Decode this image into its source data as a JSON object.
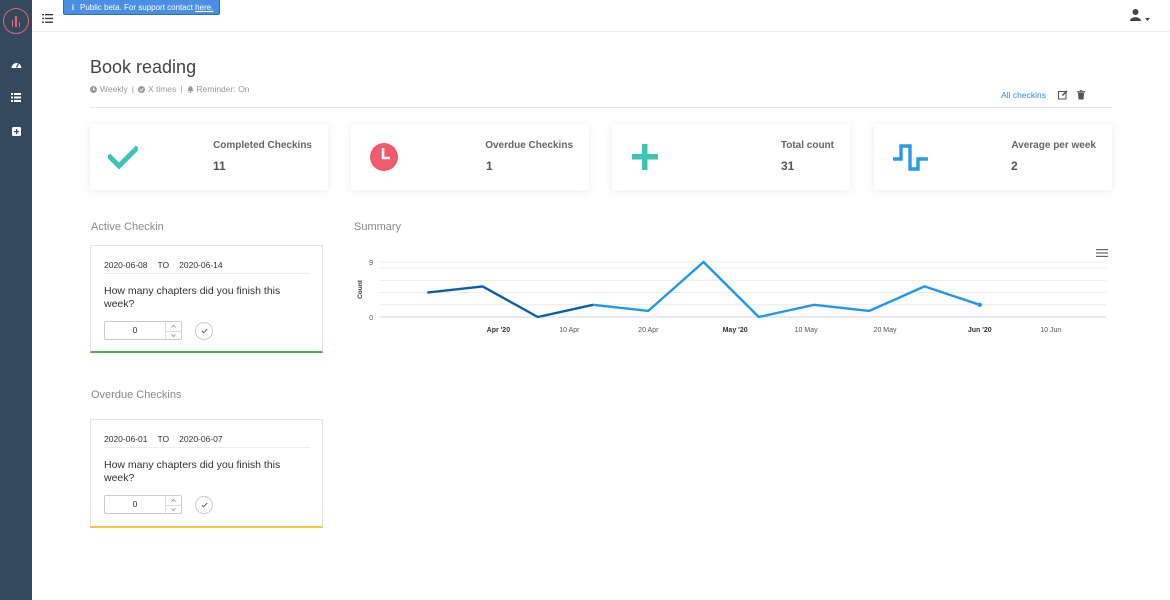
{
  "banner": {
    "info_glyph": "i",
    "text": "Public beta. For support contact ",
    "link": "here.",
    "color": "#4a90e2"
  },
  "sidebar": {
    "items": [
      {
        "icon": "dashboard-icon"
      },
      {
        "icon": "list-icon"
      },
      {
        "icon": "add-icon"
      }
    ],
    "background": "#34495e"
  },
  "header": {
    "title": "Book reading",
    "meta": {
      "frequency": "Weekly",
      "times": "X times",
      "reminder": "Reminder: On",
      "separator": "|"
    },
    "actions": {
      "all_checkins": "All checkins"
    }
  },
  "stats": [
    {
      "label": "Completed Checkins",
      "value": "11",
      "icon": "checkmark-icon",
      "color": "#3cc4b4"
    },
    {
      "label": "Overdue Checkins",
      "value": "1",
      "icon": "clock-icon",
      "color": "#ef5a6f"
    },
    {
      "label": "Total count",
      "value": "31",
      "icon": "plus-icon",
      "color": "#3cc4b4"
    },
    {
      "label": "Average per week",
      "value": "2",
      "icon": "pulse-wave-icon",
      "color": "#2b9ae8"
    }
  ],
  "active": {
    "heading": "Active Checkin",
    "from": "2020-06-08",
    "to_label": "TO",
    "to": "2020-06-14",
    "question": "How many chapters did you finish this week?",
    "value": "0"
  },
  "overdue": {
    "heading": "Overdue Checkins",
    "from": "2020-06-01",
    "to_label": "TO",
    "to": "2020-06-07",
    "question": "How many chapters did you finish this week?",
    "value": "0"
  },
  "summary": {
    "heading": "Summary"
  },
  "chart_data": {
    "type": "line",
    "title": "",
    "ylabel": "Count",
    "ylim": [
      0,
      9
    ],
    "yticks": [
      "0",
      "9"
    ],
    "xticks": [
      {
        "label": "Apr '20",
        "bold": true,
        "date": "2020-04-01"
      },
      {
        "label": "10 Apr",
        "bold": false,
        "date": "2020-04-10"
      },
      {
        "label": "20 Apr",
        "bold": false,
        "date": "2020-04-20"
      },
      {
        "label": "May '20",
        "bold": true,
        "date": "2020-05-01"
      },
      {
        "label": "10 May",
        "bold": false,
        "date": "2020-05-10"
      },
      {
        "label": "20 May",
        "bold": false,
        "date": "2020-05-20"
      },
      {
        "label": "Jun '20",
        "bold": true,
        "date": "2020-06-01"
      },
      {
        "label": "10 Jun",
        "bold": false,
        "date": "2020-06-10"
      }
    ],
    "x": [
      "2020-03-23",
      "2020-03-30",
      "2020-04-06",
      "2020-04-13",
      "2020-04-20",
      "2020-04-27",
      "2020-05-04",
      "2020-05-11",
      "2020-05-18",
      "2020-05-25",
      "2020-06-01"
    ],
    "series": [
      {
        "values": [
          4,
          5,
          0,
          2,
          1,
          9,
          0,
          2,
          1,
          5,
          2
        ],
        "color": "#2196f3",
        "dark_color": "#0d5ea8"
      }
    ],
    "grid": true,
    "legend": "none"
  }
}
